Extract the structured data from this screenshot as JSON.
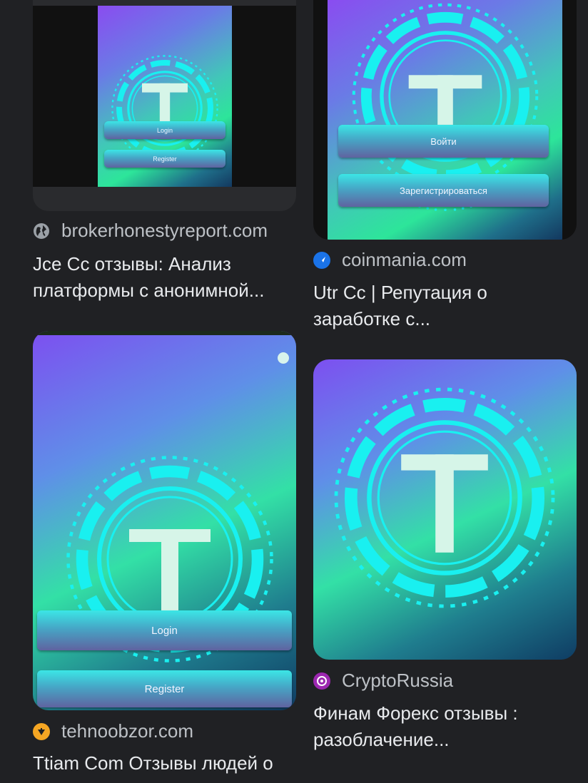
{
  "results": [
    {
      "source": "brokerhonestyreport.com",
      "title_lines": [
        "Jce Cc отзывы: Анализ",
        "платформы с анонимной..."
      ],
      "image": {
        "logo_letter": "T",
        "buttons": [
          "Login",
          "Register"
        ]
      }
    },
    {
      "source": "coinmania.com",
      "title_lines": [
        "Utr Cc | Репутация о",
        "заработке с..."
      ],
      "image": {
        "logo_letter": "T",
        "buttons": [
          "Войти",
          "Зарегистрироваться"
        ]
      }
    },
    {
      "source": "tehnoobzor.com",
      "title_lines": [
        "Ttiam Com Отзывы людей о",
        ""
      ],
      "image": {
        "logo_letter": "T",
        "buttons": [
          "Login",
          "Register"
        ]
      }
    },
    {
      "source": "CryptoRussia",
      "title_lines": [
        "Финам Форекс отзывы :",
        "разоблачение..."
      ],
      "image": {
        "logo_letter": "T"
      }
    }
  ],
  "icons": {
    "result_1": "globe-icon",
    "result_2": "coinmania-favicon-icon",
    "result_3": "tehnoobzor-favicon-icon",
    "result_4": "cryptorussia-favicon-icon"
  },
  "colors": {
    "background": "#202124",
    "text": "#e8eaed",
    "source_text": "#bdc1c6",
    "cyan": "#19f0f0"
  }
}
